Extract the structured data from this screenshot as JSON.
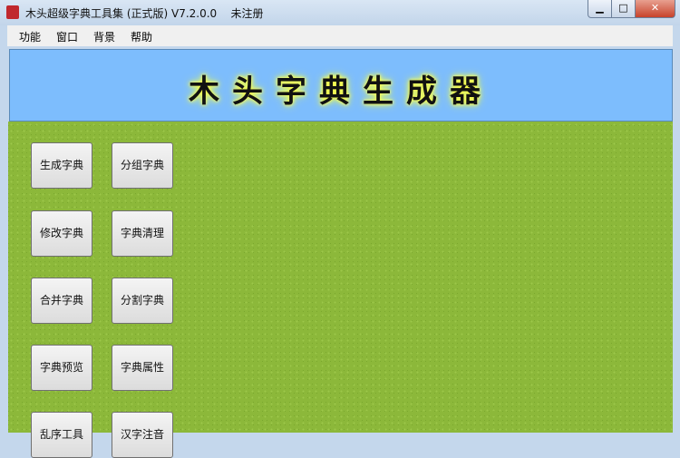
{
  "window": {
    "title": "木头超级字典工具集 (正式版) V7.2.0.0    未注册",
    "minimize": "▁",
    "maximize": "□",
    "close": "✕"
  },
  "menu": [
    "功能",
    "窗口",
    "背景",
    "帮助"
  ],
  "banner": {
    "title": "木头字典生成器"
  },
  "buttons": [
    "生成字典",
    "分组字典",
    "修改字典",
    "字典清理",
    "合并字典",
    "分割字典",
    "字典预览",
    "字典属性",
    "乱序工具",
    "汉字注音"
  ]
}
